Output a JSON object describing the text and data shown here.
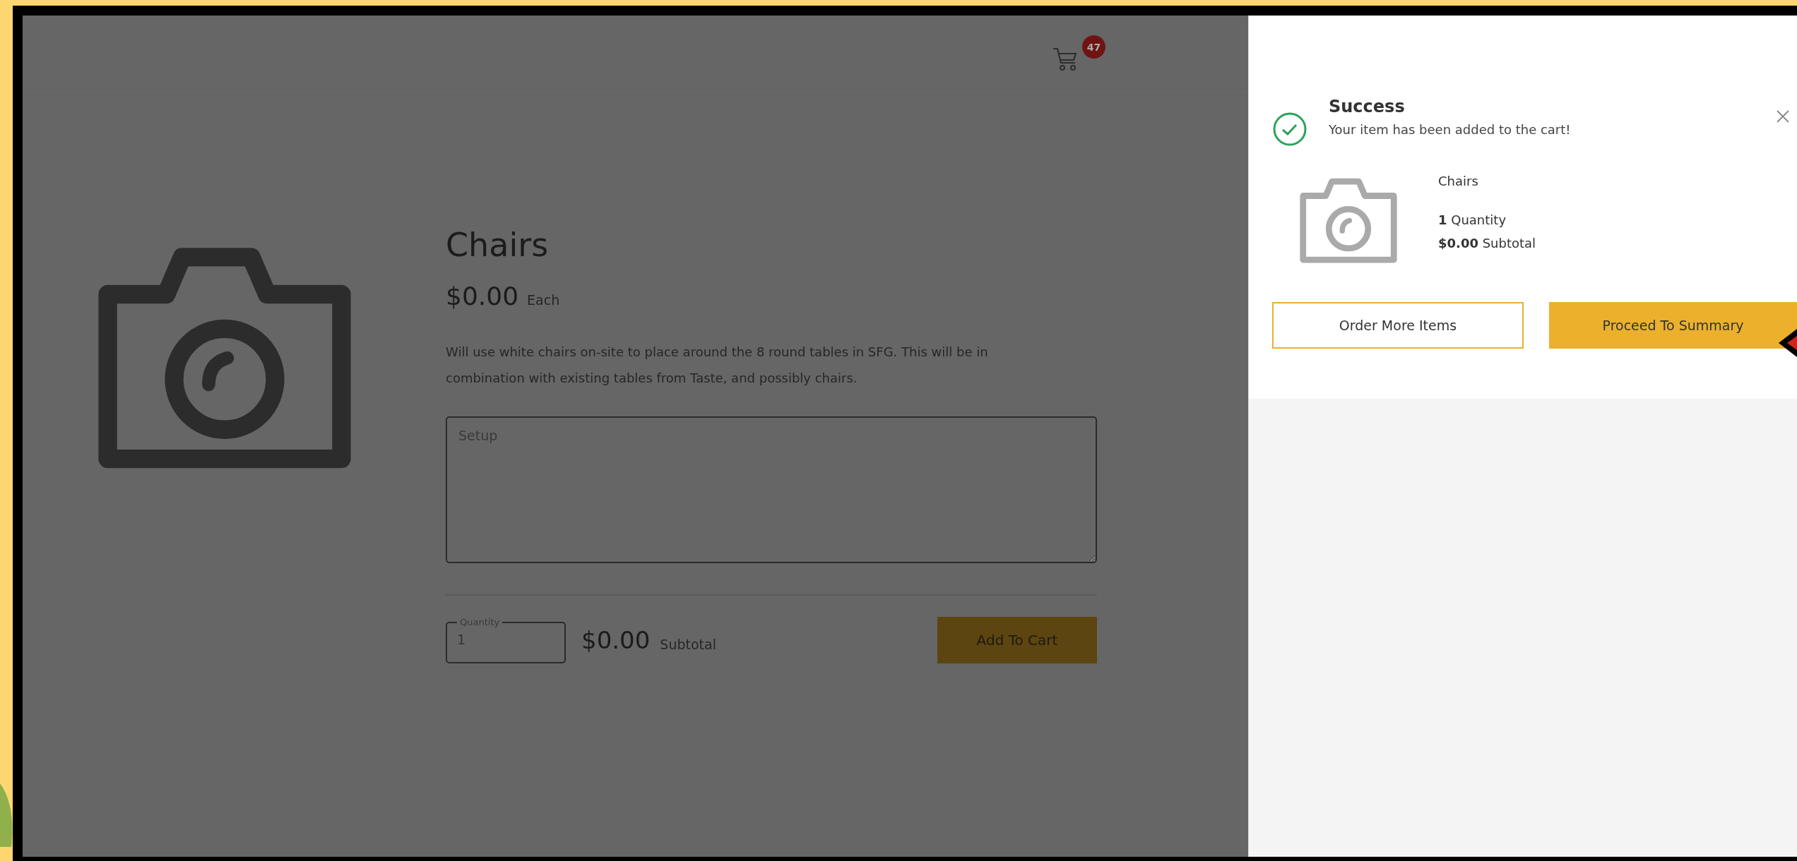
{
  "header": {
    "cart_count": "47"
  },
  "product": {
    "title": "Chairs",
    "price": "$0.00",
    "price_unit": "Each",
    "description": "Will use white chairs on-site to place around the 8 round tables in SFG. This will be in combination with existing tables from Taste, and possibly chairs.",
    "notes": {
      "placeholder": "Setup"
    },
    "quantity": {
      "label": "Quantity",
      "value": "1"
    },
    "subtotal": "$0.00",
    "subtotal_label": "Subtotal",
    "add_button": "Add To Cart"
  },
  "cart_panel": {
    "title": "Success",
    "message": "Your item has been added to the cart!",
    "item": {
      "name": "Chairs",
      "quantity": "1",
      "quantity_label": "Quantity",
      "subtotal": "$0.00",
      "subtotal_label": "Subtotal"
    },
    "buttons": [
      {
        "label": "Order More Items",
        "kind": "secondary"
      },
      {
        "label": "Proceed To Summary",
        "kind": "primary"
      }
    ]
  }
}
